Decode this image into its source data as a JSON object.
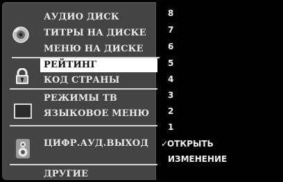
{
  "menu": {
    "groups": [
      {
        "icon": "disc-icon",
        "items": [
          "АУДИО ДИСК",
          "ТИТРЫ НА ДИСКЕ",
          "МЕНЮ НА ДИСКЕ"
        ]
      },
      {
        "icon": "padlock-icon",
        "items": [
          "РЕЙТИНГ",
          "КОД СТРАНЫ"
        ]
      },
      {
        "icon": "tv-screen-icon",
        "items": [
          "РЕЖИМЫ ТВ",
          "ЯЗЫКОВОЕ МЕНЮ"
        ]
      },
      {
        "icon": "speaker-icon",
        "items": [
          "ЦИФР.АУД.ВЫХОД"
        ]
      },
      {
        "icon": null,
        "items": [
          "ДРУГИЕ"
        ]
      }
    ],
    "selected": "РЕЙТИНГ"
  },
  "rating_options": [
    "8",
    "7",
    "6",
    "5",
    "4",
    "3",
    "2",
    "1",
    "ОТКРЫТЬ",
    "ИЗМЕНЕНИЕ"
  ],
  "current_rating": "ОТКРЫТЬ",
  "check_mark": "✓",
  "colors": {
    "background": "#000000",
    "panel": "#444444",
    "highlight": "#ffffff",
    "text": "#e9e9e9"
  }
}
